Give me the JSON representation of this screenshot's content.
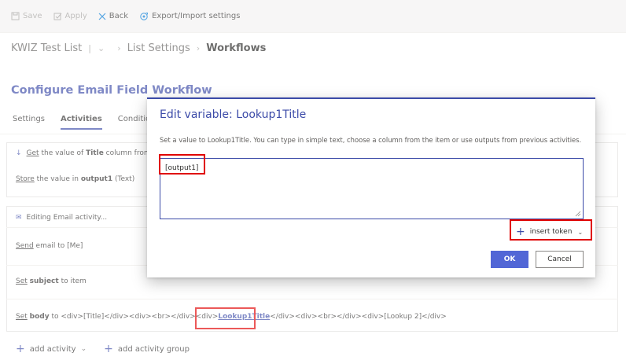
{
  "toolbar": {
    "save": "Save",
    "apply": "Apply",
    "back": "Back",
    "export_import": "Export/Import settings"
  },
  "breadcrumb": {
    "list": "KWIZ Test List",
    "divider": "|",
    "chevron": "⌄",
    "settings": "List Settings",
    "current": "Workflows"
  },
  "page": {
    "title": "Configure Email Field Workflow",
    "tabs": [
      {
        "label": "Settings",
        "selected": false
      },
      {
        "label": "Activities",
        "selected": true
      },
      {
        "label": "Conditions",
        "selected": false
      }
    ]
  },
  "activities": {
    "get_prefix": "Get",
    "get_mid": " the value of ",
    "get_column": "Title",
    "get_suffix": " column from",
    "store_prefix": "Store",
    "store_mid": " the value in ",
    "store_var": "output1",
    "store_suffix": " (Text)",
    "email_header": "Editing Email activity...",
    "send_prefix": "Send",
    "send_suffix": " email to [Me]",
    "set_prefix": "Set",
    "subject_label": "subject",
    "subject_suffix": " to item",
    "body_label": "body",
    "body_pre": " to <div>[Title]</div><div><br></div><div>",
    "body_token": "Lookup1Title",
    "body_post": "</div><div><br></div><div>[Lookup 2]</div>",
    "add_activity": "add activity",
    "add_activity_group": "add activity group"
  },
  "dialog": {
    "title": "Edit variable: Lookup1Title",
    "description": "Set a value to Lookup1Title. You can type in simple text, choose a column from the item or use outputs from previous activities.",
    "textarea_value": "[output1]",
    "insert_token": "insert token",
    "ok": "OK",
    "cancel": "Cancel"
  },
  "colors": {
    "accent": "#3b4aa8",
    "primary_button": "#5166d6",
    "highlight": "#e00000"
  }
}
